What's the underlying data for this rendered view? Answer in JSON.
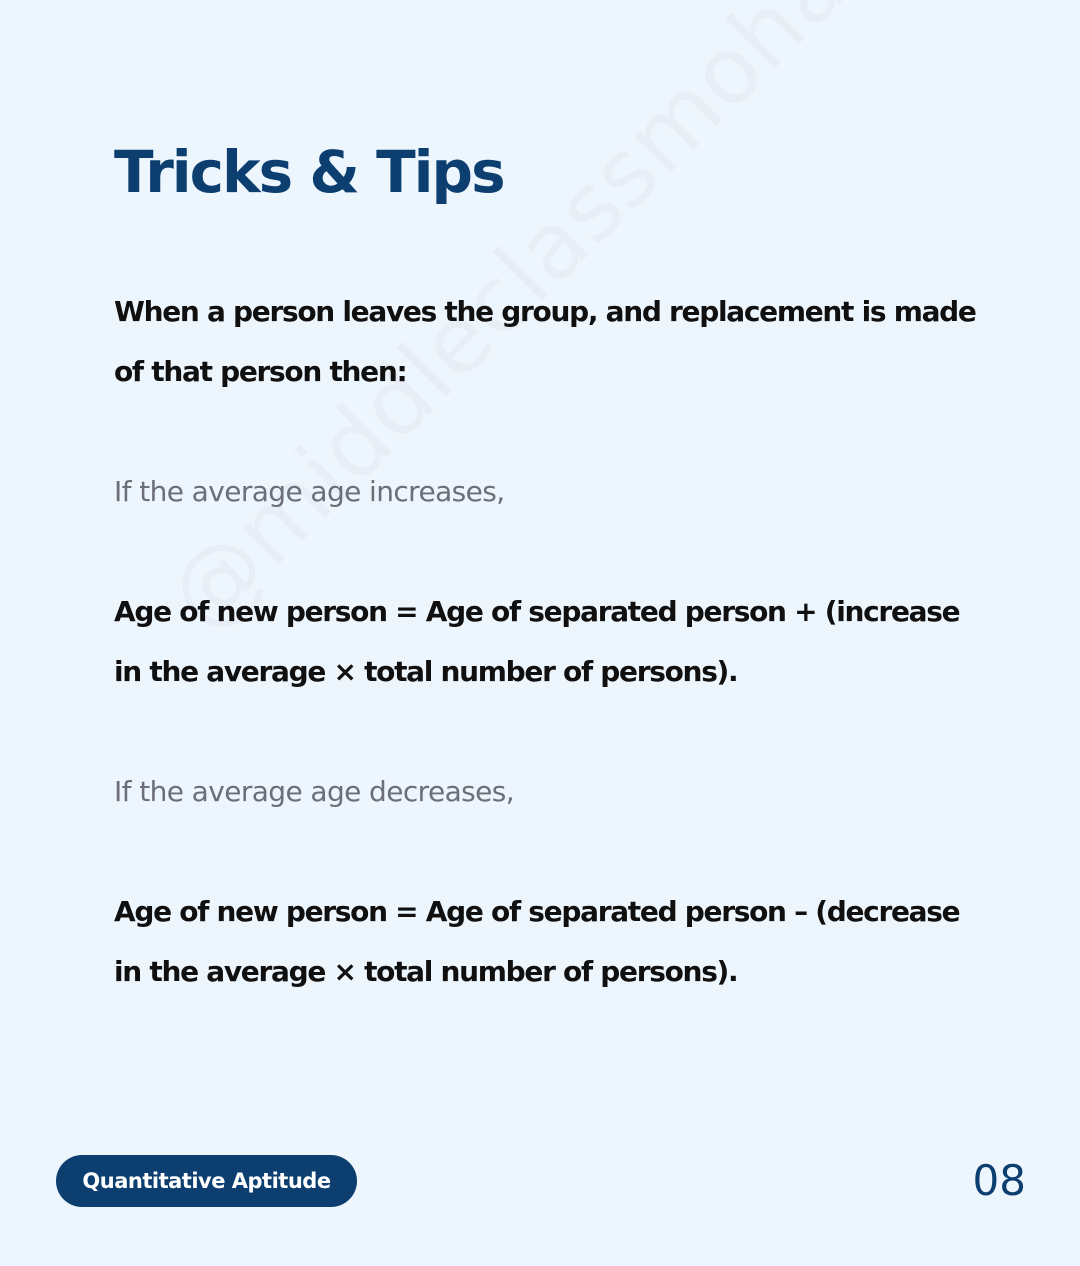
{
  "watermark": "@middleclassmohan",
  "title": "Tricks & Tips",
  "intro": "When a person leaves the group, and replacement is made of that person then:",
  "cases": [
    {
      "condition": "If the average age increases,",
      "formula": "Age of new person = Age of separated person + (increase in the average × total number of persons)."
    },
    {
      "condition": "If the average age decreases,",
      "formula": "Age of new person = Age of separated person – (decrease in the average × total number of persons)."
    }
  ],
  "footer": {
    "tag": "Quantitative Aptitude",
    "page_number": "08"
  },
  "colors": {
    "background": "#eef6fd",
    "accent": "#0c3f70",
    "body_text": "#101010",
    "muted_text": "#6c6e78"
  }
}
